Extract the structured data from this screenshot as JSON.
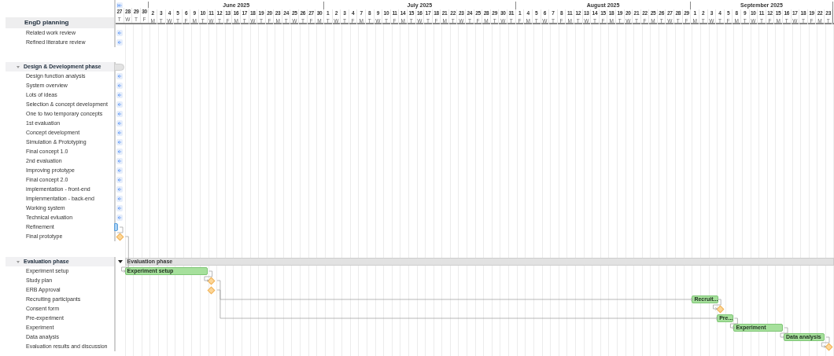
{
  "title": "EngD planning",
  "months": [
    {
      "days": [
        {
          "d": "27",
          "w": "T"
        },
        {
          "d": "28",
          "w": "W"
        },
        {
          "d": "29",
          "w": "T"
        },
        {
          "d": "30",
          "w": "F"
        }
      ]
    },
    {
      "label": "June 2025",
      "days": [
        {
          "d": "2",
          "w": "M"
        },
        {
          "d": "3",
          "w": "T"
        },
        {
          "d": "4",
          "w": "W"
        },
        {
          "d": "5",
          "w": "T"
        },
        {
          "d": "6",
          "w": "F"
        },
        {
          "d": "9",
          "w": "M"
        },
        {
          "d": "10",
          "w": "T"
        },
        {
          "d": "11",
          "w": "W"
        },
        {
          "d": "12",
          "w": "T"
        },
        {
          "d": "13",
          "w": "F"
        },
        {
          "d": "16",
          "w": "M"
        },
        {
          "d": "17",
          "w": "T"
        },
        {
          "d": "18",
          "w": "W"
        },
        {
          "d": "19",
          "w": "T"
        },
        {
          "d": "20",
          "w": "F"
        },
        {
          "d": "23",
          "w": "M"
        },
        {
          "d": "24",
          "w": "T"
        },
        {
          "d": "25",
          "w": "W"
        },
        {
          "d": "26",
          "w": "T"
        },
        {
          "d": "27",
          "w": "F"
        },
        {
          "d": "30",
          "w": "M"
        }
      ]
    },
    {
      "label": "July 2025",
      "days": [
        {
          "d": "1",
          "w": "T"
        },
        {
          "d": "2",
          "w": "W"
        },
        {
          "d": "3",
          "w": "T"
        },
        {
          "d": "4",
          "w": "F"
        },
        {
          "d": "7",
          "w": "M"
        },
        {
          "d": "8",
          "w": "T"
        },
        {
          "d": "9",
          "w": "W"
        },
        {
          "d": "10",
          "w": "T"
        },
        {
          "d": "11",
          "w": "F"
        },
        {
          "d": "14",
          "w": "M"
        },
        {
          "d": "15",
          "w": "T"
        },
        {
          "d": "16",
          "w": "W"
        },
        {
          "d": "17",
          "w": "T"
        },
        {
          "d": "18",
          "w": "F"
        },
        {
          "d": "21",
          "w": "M"
        },
        {
          "d": "22",
          "w": "T"
        },
        {
          "d": "23",
          "w": "W"
        },
        {
          "d": "24",
          "w": "T"
        },
        {
          "d": "25",
          "w": "F"
        },
        {
          "d": "28",
          "w": "M"
        },
        {
          "d": "29",
          "w": "T"
        },
        {
          "d": "30",
          "w": "W"
        },
        {
          "d": "31",
          "w": "T"
        }
      ]
    },
    {
      "label": "August 2025",
      "days": [
        {
          "d": "1",
          "w": "F"
        },
        {
          "d": "4",
          "w": "M"
        },
        {
          "d": "5",
          "w": "T"
        },
        {
          "d": "6",
          "w": "W"
        },
        {
          "d": "7",
          "w": "T"
        },
        {
          "d": "8",
          "w": "F"
        },
        {
          "d": "11",
          "w": "M"
        },
        {
          "d": "12",
          "w": "T"
        },
        {
          "d": "13",
          "w": "W"
        },
        {
          "d": "14",
          "w": "T"
        },
        {
          "d": "15",
          "w": "F"
        },
        {
          "d": "18",
          "w": "M"
        },
        {
          "d": "19",
          "w": "T"
        },
        {
          "d": "20",
          "w": "W"
        },
        {
          "d": "21",
          "w": "T"
        },
        {
          "d": "22",
          "w": "F"
        },
        {
          "d": "25",
          "w": "M"
        },
        {
          "d": "26",
          "w": "T"
        },
        {
          "d": "27",
          "w": "W"
        },
        {
          "d": "28",
          "w": "T"
        },
        {
          "d": "29",
          "w": "F"
        }
      ]
    },
    {
      "label": "September 2025",
      "days": [
        {
          "d": "1",
          "w": "M"
        },
        {
          "d": "2",
          "w": "T"
        },
        {
          "d": "3",
          "w": "W"
        },
        {
          "d": "4",
          "w": "T"
        },
        {
          "d": "5",
          "w": "F"
        },
        {
          "d": "8",
          "w": "M"
        },
        {
          "d": "9",
          "w": "T"
        },
        {
          "d": "10",
          "w": "W"
        },
        {
          "d": "11",
          "w": "T"
        },
        {
          "d": "12",
          "w": "F"
        },
        {
          "d": "15",
          "w": "M"
        },
        {
          "d": "16",
          "w": "T"
        },
        {
          "d": "17",
          "w": "W"
        },
        {
          "d": "18",
          "w": "T"
        },
        {
          "d": "19",
          "w": "F"
        },
        {
          "d": "22",
          "w": "M"
        },
        {
          "d": "23",
          "w": "T"
        }
      ]
    }
  ],
  "groups": [
    {
      "tasks": [
        {
          "label": "Related work review",
          "kind": "before"
        },
        {
          "label": "Refined literature review",
          "kind": "before"
        }
      ]
    },
    {
      "phase": {
        "label": "Design & Development phase",
        "expanded": true,
        "kind": "summary_before"
      },
      "tasks": [
        {
          "label": "Design function analysis",
          "kind": "before"
        },
        {
          "label": "System overview",
          "kind": "before"
        },
        {
          "label": "Lots of ideas",
          "kind": "before"
        },
        {
          "label": "Selection & concept development",
          "kind": "before"
        },
        {
          "label": "One to two temporary concepts",
          "kind": "before"
        },
        {
          "label": "1st evaluation",
          "kind": "before"
        },
        {
          "label": "Concept development",
          "kind": "before"
        },
        {
          "label": "Simulation & Prototyping",
          "kind": "before"
        },
        {
          "label": "Final concept 1.0",
          "kind": "before"
        },
        {
          "label": "2nd evaluation",
          "kind": "before"
        },
        {
          "label": "Improving prototype",
          "kind": "before"
        },
        {
          "label": "Final concept 2.0",
          "kind": "before"
        },
        {
          "label": "implementation - front-end",
          "kind": "before"
        },
        {
          "label": "Implenmentation - back-end",
          "kind": "before"
        },
        {
          "label": "Working system",
          "kind": "before"
        },
        {
          "label": "Technical evluation",
          "kind": "before"
        },
        {
          "label": "Refinement",
          "kind": "edge"
        },
        {
          "label": "Final prototype",
          "kind": "milestone"
        }
      ]
    },
    {
      "phase": {
        "label": "Evaluation phase",
        "expanded": true,
        "kind": "summary_open",
        "bar_label": "Evaluation phase"
      },
      "tasks": [
        {
          "label": "Experiment setup",
          "kind": "bar",
          "bar_label": "Experiment setup"
        },
        {
          "label": "Study plan",
          "kind": "milestone"
        },
        {
          "label": "ERB Approval",
          "kind": "milestone"
        },
        {
          "label": "Recruiting participants",
          "kind": "bar",
          "bar_label": "Recruit..."
        },
        {
          "label": "Consent form",
          "kind": "milestone"
        },
        {
          "label": "Pre-experiment",
          "kind": "bar",
          "bar_label": "Pre..."
        },
        {
          "label": "Experiment",
          "kind": "bar",
          "bar_label": "Experiment"
        },
        {
          "label": "Data analysis",
          "kind": "bar",
          "bar_label": "Data analysis"
        },
        {
          "label": "Evaluation results and discussion",
          "kind": "milestone"
        }
      ]
    }
  ]
}
